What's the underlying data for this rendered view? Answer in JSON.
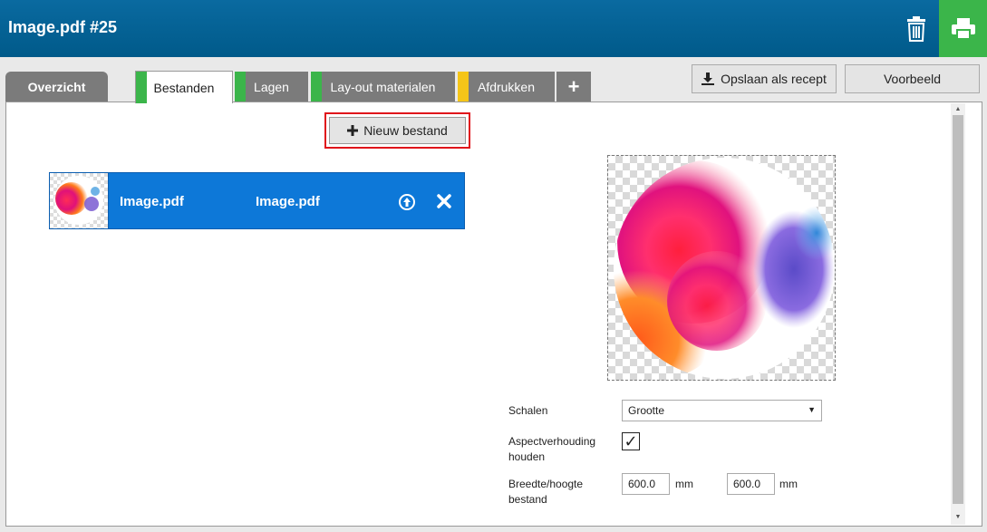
{
  "header": {
    "title": "Image.pdf #25"
  },
  "tabs": [
    {
      "label": "Overzicht"
    },
    {
      "label": "Bestanden",
      "stripe": "#3bb54a"
    },
    {
      "label": "Lagen",
      "stripe": "#3bb54a"
    },
    {
      "label": "Lay-out materialen",
      "stripe": "#3bb54a"
    },
    {
      "label": "Afdrukken",
      "stripe": "#f5c518"
    },
    {
      "label": "+"
    }
  ],
  "actions": {
    "save_recipe": "Opslaan als recept",
    "preview": "Voorbeeld"
  },
  "new_file": {
    "label": "Nieuw bestand"
  },
  "files": [
    {
      "name": "Image.pdf",
      "display_name": "Image.pdf"
    }
  ],
  "form": {
    "scale_label": "Schalen",
    "scale_value": "Grootte",
    "aspect_label": "Aspectverhouding houden",
    "aspect_checked": true,
    "size_label": "Breedte/hoogte bestand",
    "width": "600.0",
    "height": "600.0",
    "unit": "mm"
  },
  "colors": {
    "header": "#005a8a",
    "print": "#3bb54a",
    "selected_row": "#0d78d8",
    "highlight": "#e0131b"
  }
}
